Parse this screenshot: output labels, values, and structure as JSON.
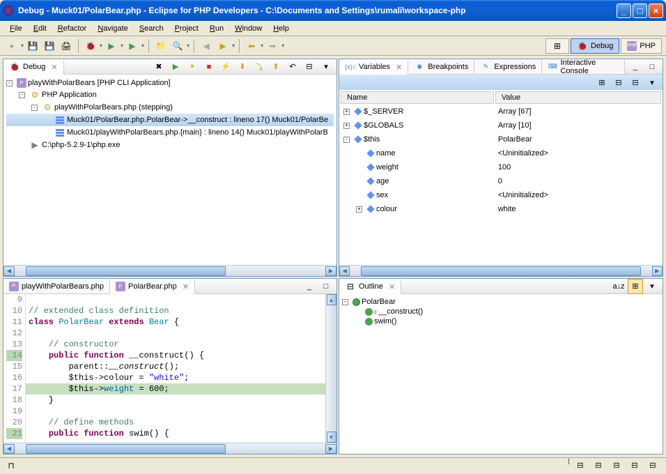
{
  "window": {
    "title": "Debug - Muck01/PolarBear.php - Eclipse for PHP Developers - C:\\Documents and Settings\\rumali\\workspace-php"
  },
  "menu": [
    "File",
    "Edit",
    "Refactor",
    "Navigate",
    "Search",
    "Project",
    "Run",
    "Window",
    "Help"
  ],
  "perspectives": {
    "debug": "Debug",
    "php": "PHP"
  },
  "debug_view": {
    "tab": "Debug",
    "tree": [
      {
        "level": 0,
        "exp": "-",
        "icon": "php",
        "label": "playWithPolarBears [PHP CLI Application]"
      },
      {
        "level": 1,
        "exp": "-",
        "icon": "gear",
        "label": "PHP Application"
      },
      {
        "level": 2,
        "exp": "-",
        "icon": "thread",
        "label": "playWithPolarBears.php (stepping)"
      },
      {
        "level": 3,
        "exp": "",
        "icon": "stack",
        "label": "Muck01/PolarBear.php.PolarBear->__construct : lineno 17() Muck01/PolarBe",
        "selected": true
      },
      {
        "level": 3,
        "exp": "",
        "icon": "stack",
        "label": "Muck01/playWithPolarBears.php.{main} : lineno 14() Muck01/playWithPolarB"
      },
      {
        "level": 1,
        "exp": "",
        "icon": "exe",
        "label": "C:\\php-5.2.9-1\\php.exe"
      }
    ]
  },
  "variables_view": {
    "tabs": [
      "Variables",
      "Breakpoints",
      "Expressions",
      "Interactive Console"
    ],
    "columns": {
      "name": "Name",
      "value": "Value"
    },
    "rows": [
      {
        "level": 0,
        "exp": "+",
        "name": "$_SERVER",
        "value": "Array [67]"
      },
      {
        "level": 0,
        "exp": "+",
        "name": "$GLOBALS",
        "value": "Array [10]"
      },
      {
        "level": 0,
        "exp": "-",
        "name": "$this",
        "value": "PolarBear"
      },
      {
        "level": 1,
        "exp": "",
        "name": "name",
        "value": "<Uninitialized>"
      },
      {
        "level": 1,
        "exp": "",
        "name": "weight",
        "value": "100"
      },
      {
        "level": 1,
        "exp": "",
        "name": "age",
        "value": "0"
      },
      {
        "level": 1,
        "exp": "",
        "name": "sex",
        "value": "<Uninitialized>"
      },
      {
        "level": 1,
        "exp": "+",
        "name": "colour",
        "value": "white"
      }
    ]
  },
  "editor": {
    "tabs": [
      {
        "label": "playWithPolarBears.php",
        "active": false
      },
      {
        "label": "PolarBear.php",
        "active": true
      }
    ],
    "lines": [
      {
        "n": 9,
        "text": ""
      },
      {
        "n": 10,
        "text": "// extended class definition",
        "cls": "com"
      },
      {
        "n": 11,
        "html": "<span class='kw'>class</span> <span class='type'>PolarBear</span> <span class='kw'>extends</span> <span class='type'>Bear</span> {"
      },
      {
        "n": 12,
        "text": ""
      },
      {
        "n": 13,
        "text": "    // constructor",
        "cls": "com"
      },
      {
        "n": 14,
        "html": "    <span class='kw'>public function</span> __construct() {",
        "mark": true
      },
      {
        "n": 15,
        "html": "        parent::<span class='func'>__construct</span>();"
      },
      {
        "n": 16,
        "html": "        $this-&gt;colour = <span class='str'>\"white\"</span>;"
      },
      {
        "n": 17,
        "html": "        $this-&gt;<span style='color:#0060a0'>weight</span> = 600;",
        "highlight": true,
        "current": true
      },
      {
        "n": 18,
        "text": "    }"
      },
      {
        "n": 19,
        "text": ""
      },
      {
        "n": 20,
        "text": "    // define methods",
        "cls": "com"
      },
      {
        "n": 21,
        "html": "    <span class='kw'>public function</span> swim() {",
        "mark": true
      }
    ]
  },
  "outline": {
    "tab": "Outline",
    "tree": [
      {
        "level": 0,
        "exp": "-",
        "icon": "class",
        "label": "PolarBear"
      },
      {
        "level": 1,
        "exp": "",
        "icon": "method",
        "label": "__construct()",
        "sup": "c"
      },
      {
        "level": 1,
        "exp": "",
        "icon": "method",
        "label": "swim()"
      }
    ]
  }
}
